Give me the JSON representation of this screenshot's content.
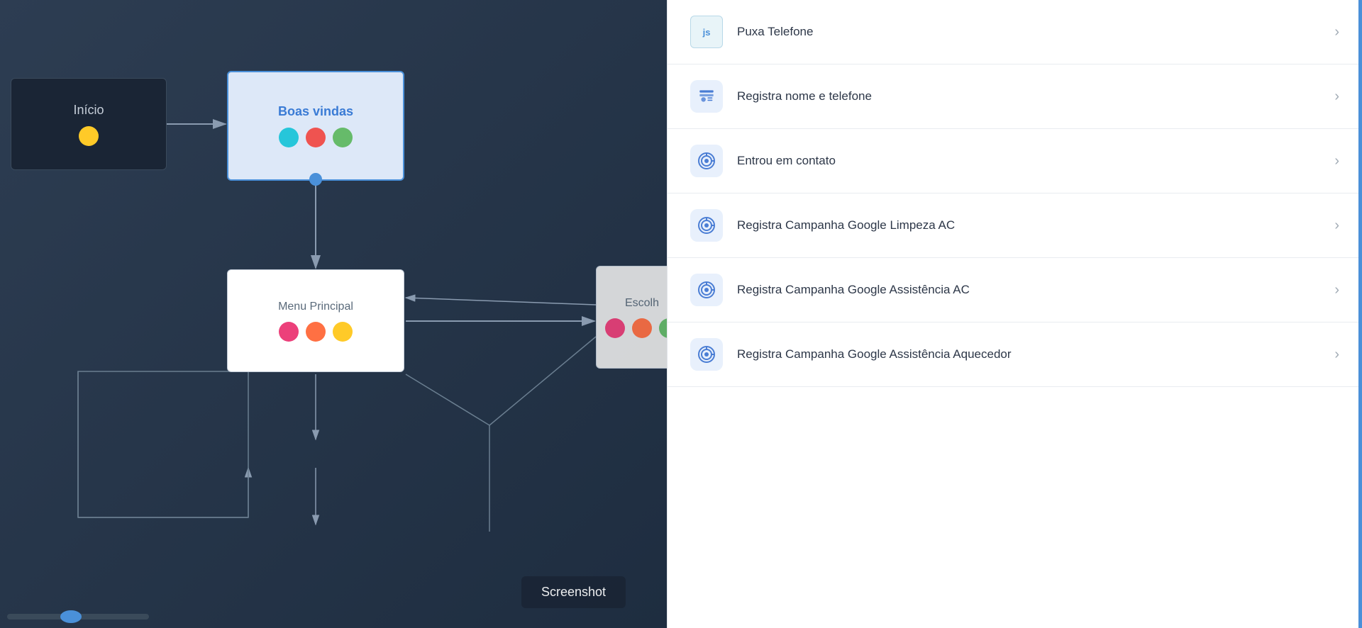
{
  "canvas": {
    "nodes": {
      "inicio": {
        "label": "Início"
      },
      "boas_vindas": {
        "label": "Boas vindas"
      },
      "menu_principal": {
        "label": "Menu Principal"
      },
      "escolha": {
        "label": "Escolh"
      }
    },
    "screenshot_button": "Screenshot"
  },
  "panel": {
    "items": [
      {
        "icon_type": "js",
        "icon_label": "js",
        "label": "Puxa Telefone"
      },
      {
        "icon_type": "contact",
        "icon_label": "👤",
        "label": "Registra nome e telefone"
      },
      {
        "icon_type": "target",
        "icon_label": "🎯",
        "label": "Entrou em contato"
      },
      {
        "icon_type": "target",
        "icon_label": "🎯",
        "label": "Registra Campanha Google Limpeza AC"
      },
      {
        "icon_type": "target",
        "icon_label": "🎯",
        "label": "Registra Campanha Google Assistência AC"
      },
      {
        "icon_type": "target",
        "icon_label": "🎯",
        "label": "Registra Campanha Google Assistência Aquecedor"
      }
    ]
  }
}
